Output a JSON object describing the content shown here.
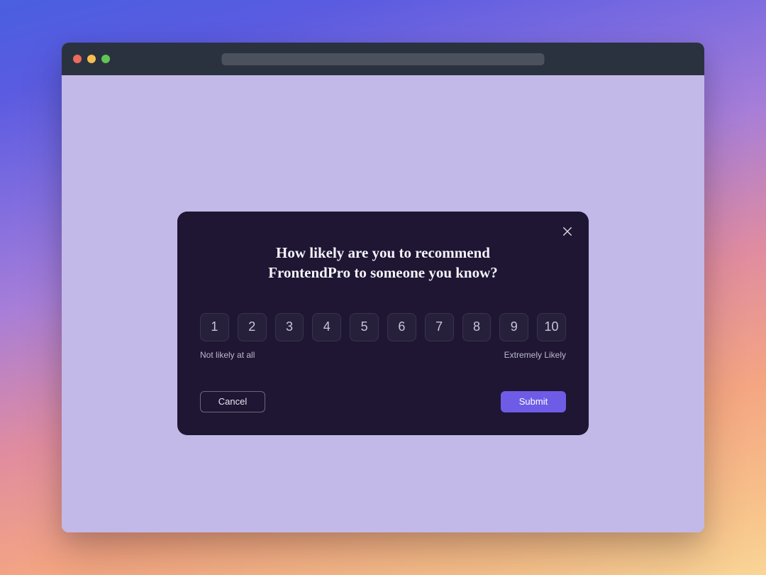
{
  "modal": {
    "question": "How likely are you to recommend FrontendPro to someone you know?",
    "low_label": "Not likely at all",
    "high_label": "Extremely Likely",
    "cancel_label": "Cancel",
    "submit_label": "Submit",
    "options": {
      "o1": "1",
      "o2": "2",
      "o3": "3",
      "o4": "4",
      "o5": "5",
      "o6": "6",
      "o7": "7",
      "o8": "8",
      "o9": "9",
      "o10": "10"
    }
  },
  "colors": {
    "modal_bg": "#1e1633",
    "submit_bg": "#6e5ce6",
    "viewport_bg": "#c3b9e8"
  }
}
